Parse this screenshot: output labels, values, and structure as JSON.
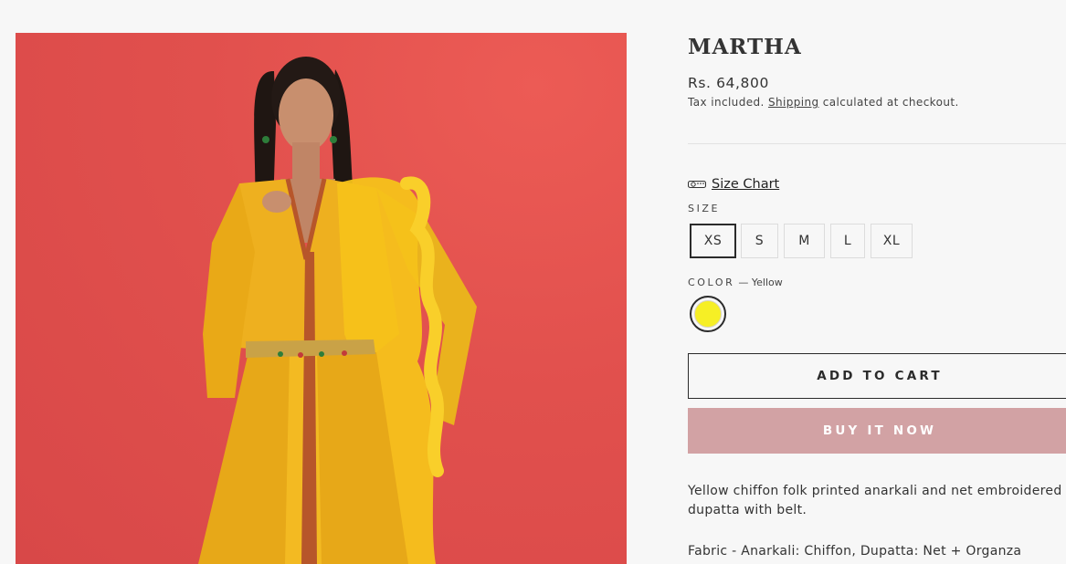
{
  "product": {
    "title": "MARTHA",
    "price": "Rs. 64,800",
    "tax_prefix": "Tax included.",
    "tax_link": "Shipping",
    "tax_suffix": "calculated at checkout.",
    "image_alt": "Model wearing yellow chiffon anarkali with net dupatta and embroidered belt"
  },
  "size_chart": {
    "label": "Size Chart",
    "icon": "measuring-tape-icon"
  },
  "size": {
    "label": "SIZE",
    "selected": "XS",
    "options": [
      "XS",
      "S",
      "M",
      "L",
      "XL"
    ]
  },
  "color": {
    "label": "COLOR",
    "selected_text": "— Yellow",
    "swatch": "#f6ef25"
  },
  "actions": {
    "add_to_cart": "ADD TO CART",
    "buy_now": "BUY IT NOW"
  },
  "description": {
    "text": "Yellow chiffon folk printed anarkali and net embroidered dupatta with belt.",
    "fabric": "Fabric - Anarkali: Chiffon, Dupatta: Net + Organza"
  },
  "colors": {
    "background": "#f7f7f7",
    "image_background": "#e1504d",
    "outfit": "#f0b21c",
    "buy_button": "#d2a2a4",
    "text": "#2b2b2b"
  }
}
